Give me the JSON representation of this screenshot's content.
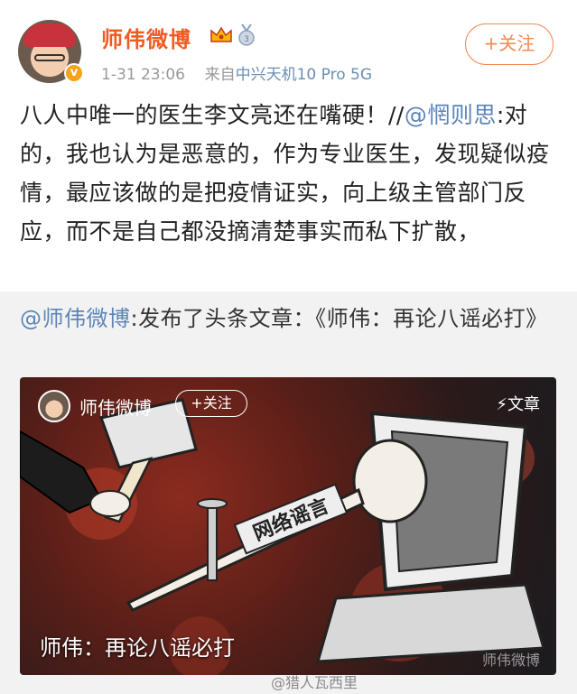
{
  "user": {
    "name": "师伟微博",
    "verified_badge": "v",
    "time": "1-31 23:06",
    "source_prefix": "来自",
    "source_device": "中兴天机10 Pro 5G",
    "follow_label": "+关注"
  },
  "post": {
    "text_before": "八人中唯一的医生李文亮还在嘴硬！//",
    "mention": "@惘则思",
    "text_after": ":对的，我也认为是恶意的，作为专业医生，发现疑似疫情，最应该做的是把疫情证实，向上级主管部门反应，而不是自己都没摘清楚事实而私下扩散，"
  },
  "repost": {
    "mention": "@师伟微博",
    "text": ":发布了头条文章：《师伟：再论八谣必打》"
  },
  "article_card": {
    "author": "师伟微博",
    "follow_label": "+关注",
    "tag": "⚡文章",
    "banner_text": "网络谣言",
    "title": "师伟：再论八谣必打",
    "watermark": "师伟微博"
  },
  "bottom_watermark": "@猎人瓦西里",
  "colors": {
    "username": "#f15a22",
    "mention": "#5b85b8",
    "follow": "#f28a52",
    "repost_bg": "#f2f2f2"
  },
  "icons": [
    "crown-icon",
    "medal-icon",
    "verified-icon",
    "lightning-icon",
    "weibo-logo-icon"
  ]
}
